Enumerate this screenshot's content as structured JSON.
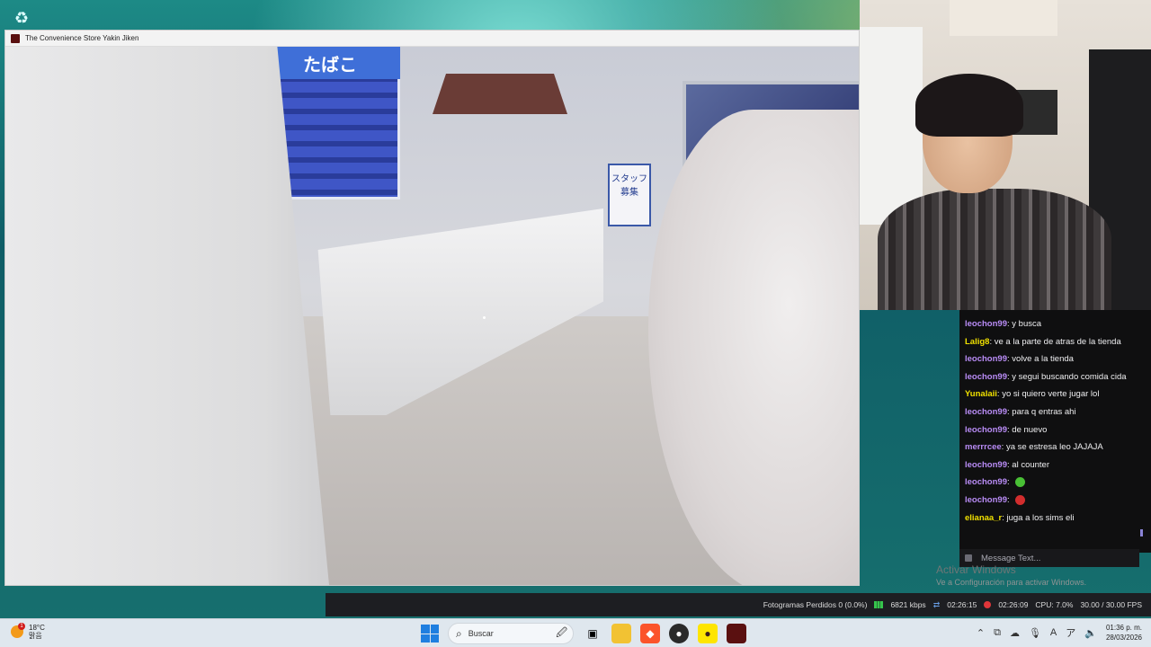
{
  "desktop": {
    "recycle_bin_icon": "recycle-bin-icon"
  },
  "game_window": {
    "title": "The Convenience Store Yakin Jiken",
    "scene": {
      "cigarette_sign": "たばこ",
      "poster_text": "スタッフ 募集"
    }
  },
  "chat": {
    "messages": [
      {
        "user": "leochon99",
        "user_color": "#b98cf6",
        "text": "y busca",
        "emote": null
      },
      {
        "user": "Lalig8",
        "user_color": "#f0e000",
        "text": "ve a la parte de atras de la tienda",
        "emote": null
      },
      {
        "user": "leochon99",
        "user_color": "#b98cf6",
        "text": "volve a la tienda",
        "emote": null
      },
      {
        "user": "leochon99",
        "user_color": "#b98cf6",
        "text": "y segui buscando comida cida",
        "emote": null
      },
      {
        "user": "Yunalaii",
        "user_color": "#f0e000",
        "text": "yo si quiero verte jugar lol",
        "emote": null
      },
      {
        "user": "leochon99",
        "user_color": "#b98cf6",
        "text": "para q entras ahi",
        "emote": null
      },
      {
        "user": "leochon99",
        "user_color": "#b98cf6",
        "text": "de nuevo",
        "emote": null
      },
      {
        "user": "merrrcee",
        "user_color": "#b98cf6",
        "text": "ya se estresa leo JAJAJA",
        "emote": null
      },
      {
        "user": "leochon99",
        "user_color": "#b98cf6",
        "text": "al counter",
        "emote": null
      },
      {
        "user": "leochon99",
        "user_color": "#b98cf6",
        "text": "",
        "emote": "#49c035"
      },
      {
        "user": "leochon99",
        "user_color": "#b98cf6",
        "text": "",
        "emote": "#d22d2d"
      },
      {
        "user": "elianaa_r",
        "user_color": "#f0e000",
        "text": "juga a los sims eli",
        "emote": null
      }
    ],
    "input_placeholder": "Message Text..."
  },
  "activation": {
    "title": "Activar Windows",
    "subtitle": "Ve a Configuración para activar Windows."
  },
  "obs_status": {
    "dropped_frames": "Fotogramas Perdidos 0 (0.0%)",
    "bitrate": "6821 kbps",
    "stream_time": "02:26:15",
    "record_time": "02:26:09",
    "cpu": "CPU: 7.0%",
    "fps": "30.00 / 30.00 FPS"
  },
  "taskbar": {
    "weather_temp": "18°C",
    "weather_desc": "맑음",
    "weather_badge": "1",
    "search_placeholder": "Buscar",
    "time": "01:36 p. m.",
    "date": "28/03/2026"
  }
}
